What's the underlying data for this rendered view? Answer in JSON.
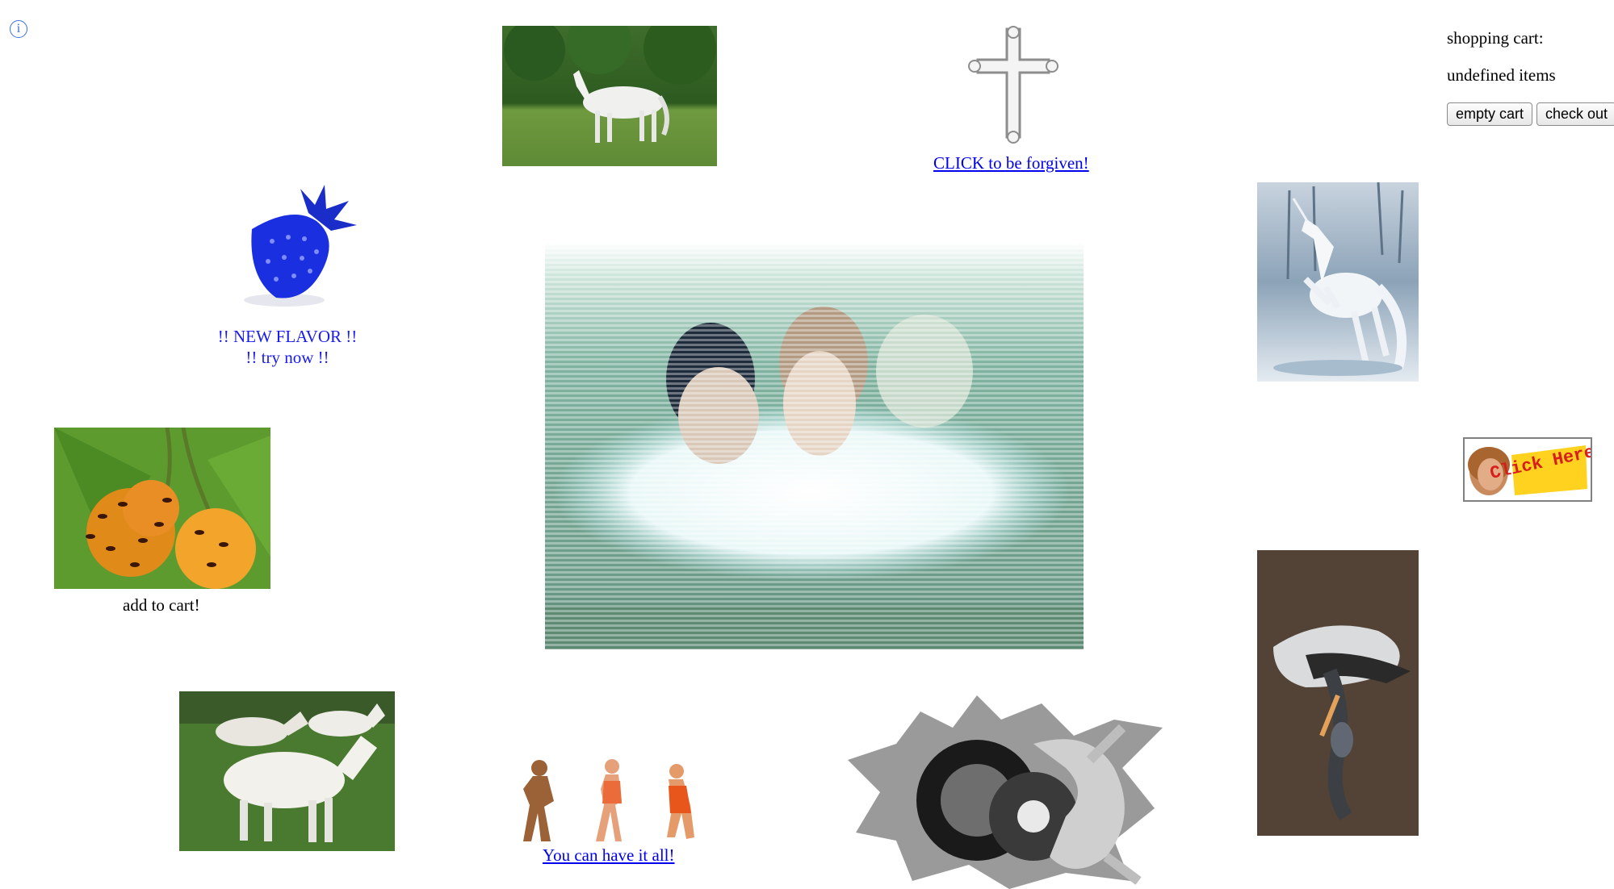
{
  "info": {
    "glyph": "i"
  },
  "cart": {
    "title": "shopping cart:",
    "count_text": "undefined items",
    "empty_label": "empty cart",
    "checkout_label": "check out"
  },
  "links": {
    "forgiven": "CLICK to be forgiven!",
    "have_it_all": "You can have it all!"
  },
  "promo": {
    "line1": "!! NEW FLAVOR !!",
    "line2": "!! try now !!"
  },
  "cherries": {
    "caption": "add to cart!"
  },
  "click_ad": {
    "text": "Click Here!"
  },
  "colors": {
    "link": "#0000ee",
    "promo_text": "#1a1aee",
    "strawberry": "#1a2fe0",
    "page_background": "#ffffff"
  },
  "images": [
    "white-horse-photo",
    "silver-cross-image",
    "blue-strawberry-image",
    "unicorn-image",
    "ants-on-cherries-photo",
    "two-women-ascii-art-image",
    "click-here-ad-banner",
    "goats-photo",
    "three-dancing-figures-image",
    "gray-gears-collage-image",
    "dead-bird-photo"
  ]
}
